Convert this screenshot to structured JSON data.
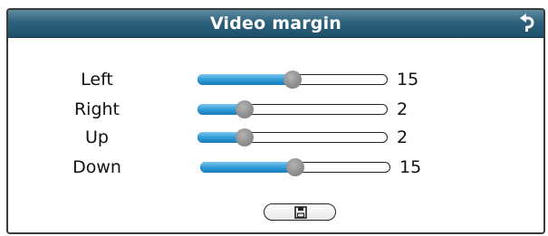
{
  "dialog": {
    "title": "Video margin",
    "back_icon": "return-arrow-icon",
    "save_icon": "floppy-disk-icon"
  },
  "margins": [
    {
      "label": "Left",
      "value": "15",
      "level": 15
    },
    {
      "label": "Right",
      "value": "2",
      "level": 2
    },
    {
      "label": "Up",
      "value": "2",
      "level": 2
    },
    {
      "label": "Down",
      "value": "15",
      "level": 15
    }
  ],
  "colors": {
    "titlebar": "#2e627c",
    "slider_fill": "#2c98d5",
    "thumb": "#8f8f8f"
  }
}
